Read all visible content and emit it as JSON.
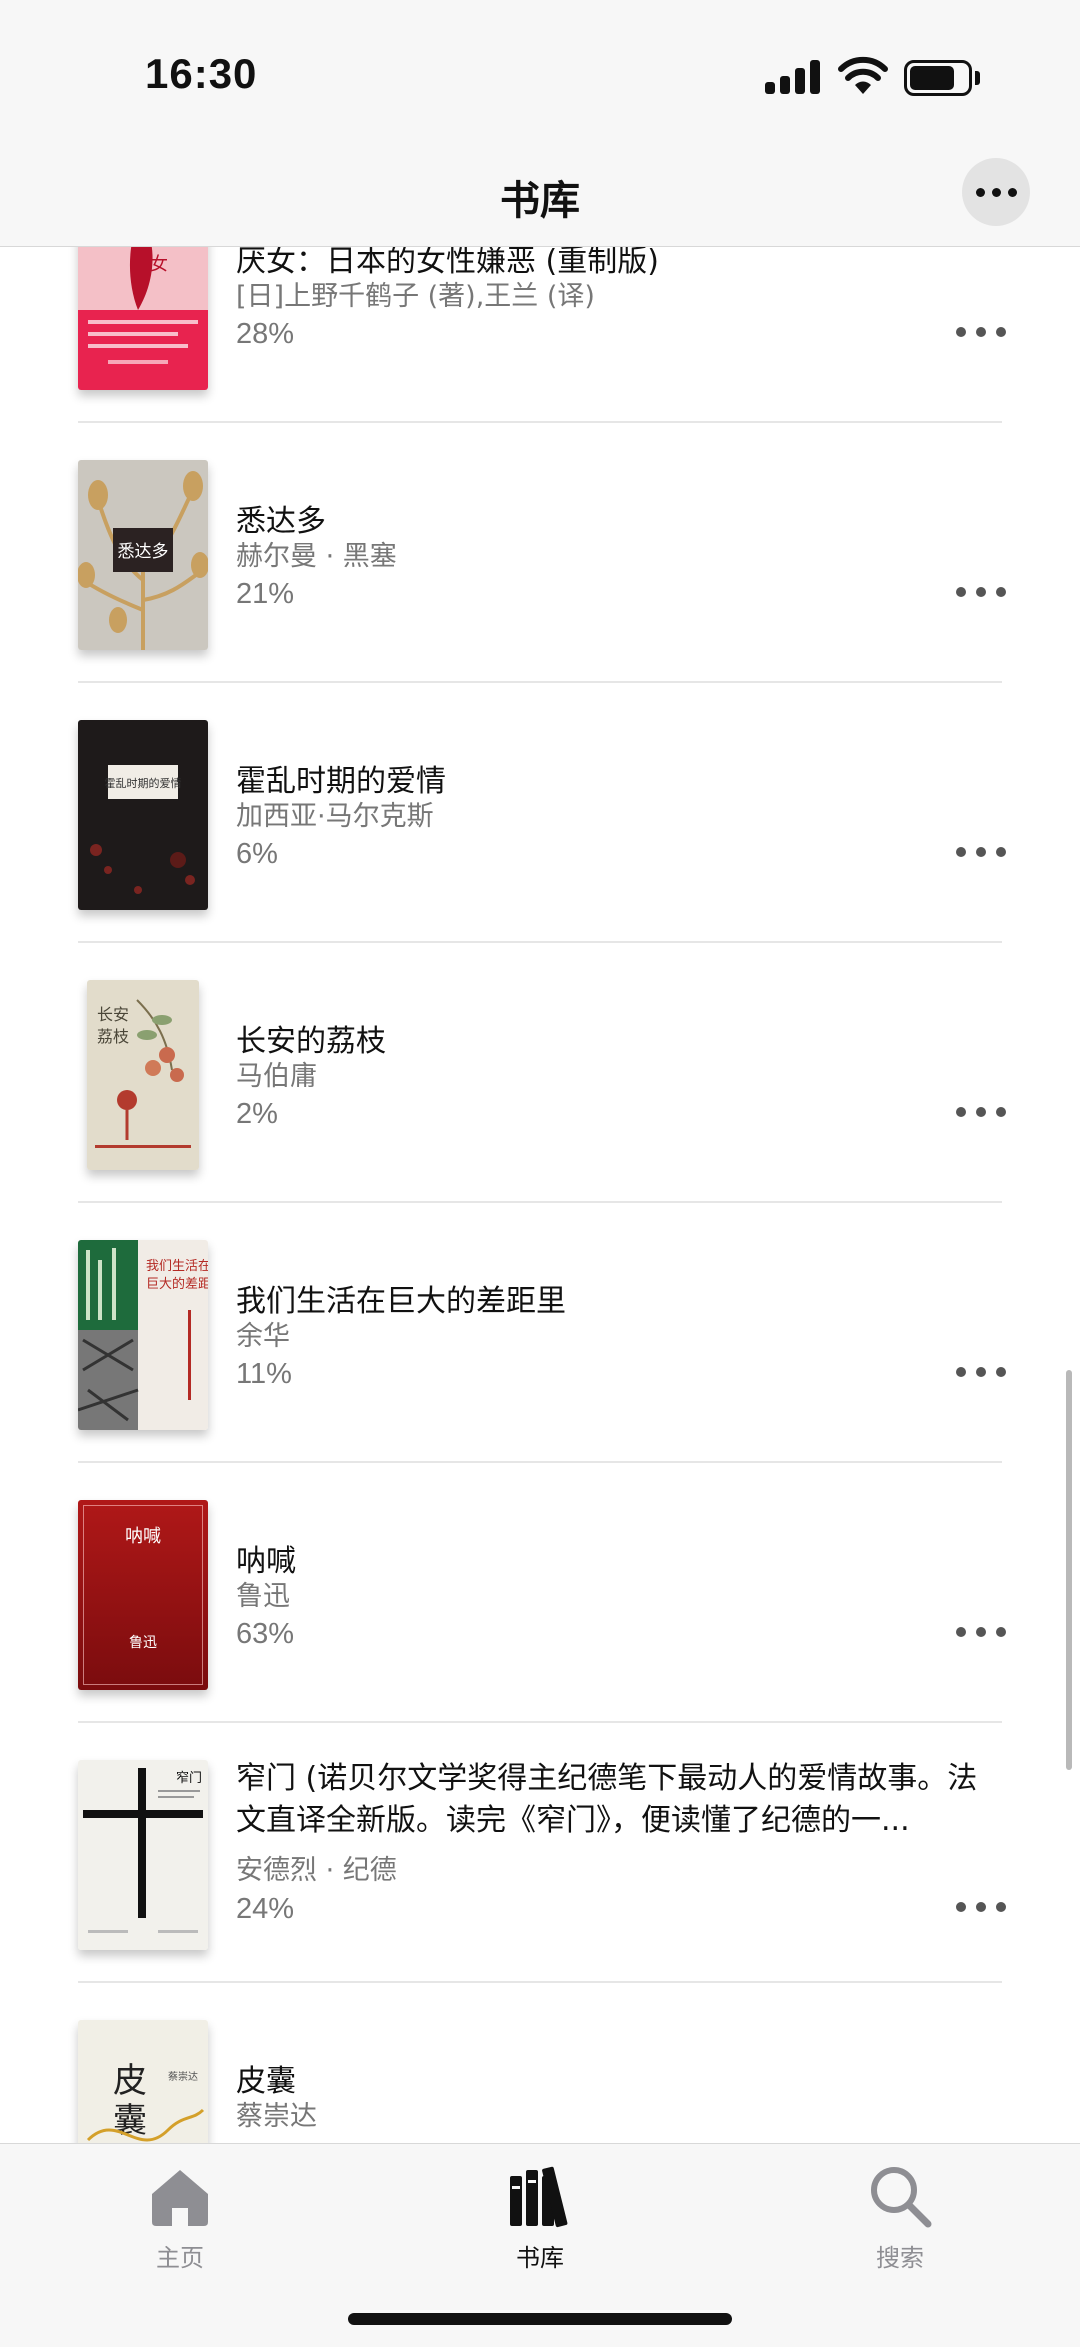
{
  "status_bar": {
    "time": "16:30"
  },
  "nav": {
    "title": "书库"
  },
  "books": [
    {
      "title": "厌女：日本的女性嫌恶 (重制版)",
      "author": "[日]上野千鹤子 (著),王兰 (译)",
      "progress": "28%",
      "cover_color": "#e8234f",
      "cover_text": "厌 女"
    },
    {
      "title": "悉达多",
      "author": "赫尔曼 · 黑塞",
      "progress": "21%",
      "cover_color": "#c9c5bd",
      "cover_text": "悉达多"
    },
    {
      "title": "霍乱时期的爱情",
      "author": "加西亚·马尔克斯",
      "progress": "6%",
      "cover_color": "#1e1a1a",
      "cover_text": "霍乱时期的爱情"
    },
    {
      "title": "长安的荔枝",
      "author": "马伯庸",
      "progress": "2%",
      "cover_color": "#e2dccb",
      "cover_text": "长安的荔枝"
    },
    {
      "title": "我们生活在巨大的差距里",
      "author": "余华",
      "progress": "11%",
      "cover_color": "#f1ece6",
      "cover_text": "我们生活在巨大的差距里"
    },
    {
      "title": "呐喊",
      "author": "鲁迅",
      "progress": "63%",
      "cover_color": "#8e0f10",
      "cover_text": "呐喊",
      "cover_subtext": "鲁迅"
    },
    {
      "title": "窄门 (诺贝尔文学奖得主纪德笔下最动人的爱情故事。法文直译全新版。读完《窄门》，便读懂了纪德的一...",
      "author": "安德烈 · 纪德",
      "progress": "24%",
      "cover_color": "#f2f1ec",
      "cover_text": "窄门"
    },
    {
      "title": "皮囊",
      "author": "蔡崇达",
      "progress": "",
      "cover_color": "#f1efe6",
      "cover_text": "皮 囊"
    }
  ],
  "tabs": [
    {
      "label": "主页",
      "icon": "house-icon",
      "color": "#8e8e93"
    },
    {
      "label": "书库",
      "icon": "books-icon",
      "color": "#111111"
    },
    {
      "label": "搜索",
      "icon": "search-icon",
      "color": "#8e8e93"
    }
  ]
}
